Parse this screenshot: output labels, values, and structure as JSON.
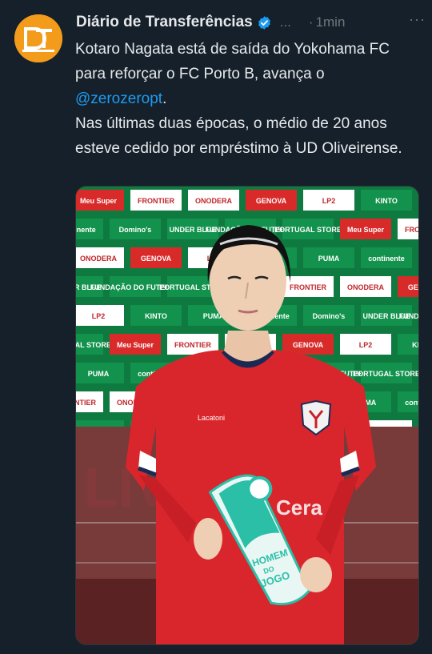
{
  "tweet": {
    "author_name": "Diário de Transferências",
    "author_initials": "DT",
    "truncation": "...",
    "separator": "·",
    "time": "1min",
    "more": "···",
    "line1": "Kotaro Nagata está de saída do Yokohama FC para reforçar o FC Porto B, avança o ",
    "mention": "@zerozeropt",
    "line1_end": ".",
    "line2": "Nas últimas duas épocas, o médio de 20 anos esteve cedido por empréstimo à UD Oliveirense."
  },
  "photo": {
    "sponsors": [
      "Meu Super",
      "FRONTIER",
      "ONODERA",
      "GENOVA",
      "LP2",
      "KINTO",
      "PUMA",
      "continente",
      "Domino's",
      "UNDER BLUE",
      "FUNDAÇÃO DO FUTEBOL",
      "PORTUGAL STORE"
    ],
    "shirt_brand": "Lacatoni",
    "shirt_sponsor": "Cera",
    "trophy_line1": "HOMEM",
    "trophy_line2": "DO",
    "trophy_line3": "JOGO",
    "wall_text": "LIVE",
    "colors": {
      "board": "#0e7a40",
      "shirt": "#d9262c",
      "trophy": "#2bbfa8"
    }
  }
}
